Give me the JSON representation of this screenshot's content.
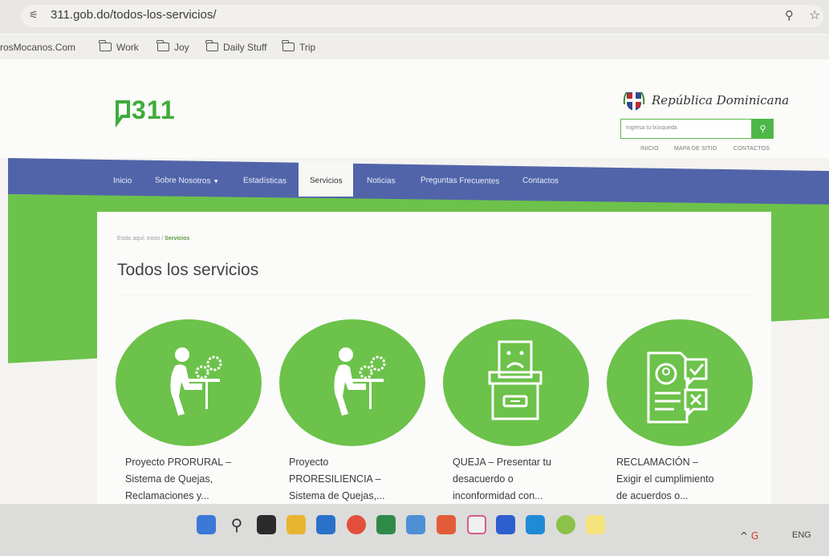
{
  "browser": {
    "url": "311.gob.do/todos-los-servicios/",
    "bookmarks": [
      "rosMocanos.Com",
      "Work",
      "Joy",
      "Daily Stuff",
      "Trip"
    ]
  },
  "header": {
    "logo_text": "311",
    "country_name": "República Dominicana",
    "search_placeholder": "Ingresa tu búsqueda",
    "utility_links": [
      "INICIO",
      "MAPA DE SITIO",
      "CONTACTOS"
    ]
  },
  "nav": {
    "items": [
      "Inicio",
      "Sobre Nosotros",
      "Estadísticas",
      "Servicios",
      "Noticias",
      "Preguntas Frecuentes",
      "Contactos"
    ],
    "active": "Servicios"
  },
  "main": {
    "breadcrumb_prefix": "Estás aquí: Inicio /",
    "breadcrumb_current": "Servicios",
    "title": "Todos los servicios",
    "services": [
      {
        "lines": [
          "Proyecto PRORURAL –",
          "Sistema de Quejas,",
          "Reclamaciones y..."
        ],
        "icon": "person-gears-icon"
      },
      {
        "lines": [
          "Proyecto",
          "PRORESILIENCIA –",
          "Sistema de Quejas,..."
        ],
        "icon": "person-gears-icon"
      },
      {
        "lines": [
          "QUEJA – Presentar tu",
          "desacuerdo o",
          "inconformidad con..."
        ],
        "icon": "complaint-box-icon"
      },
      {
        "lines": [
          "RECLAMACIÓN –",
          "Exigir el cumplimiento",
          "de acuerdos o..."
        ],
        "icon": "claim-document-icon"
      }
    ]
  },
  "taskbar": {
    "language": "ENG"
  },
  "colors": {
    "brand_green": "#6cc24a",
    "nav_blue": "#5164a9"
  }
}
